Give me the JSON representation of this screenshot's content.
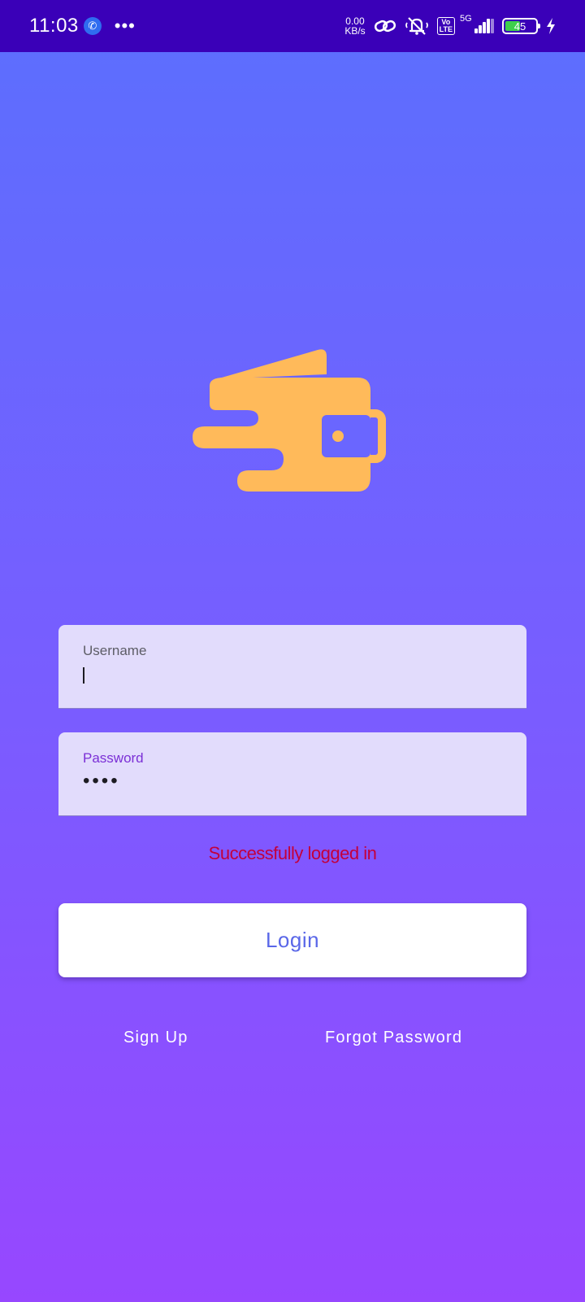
{
  "status_bar": {
    "time": "11:03",
    "overflow": "•••",
    "net_speed_value": "0.00",
    "net_speed_unit": "KB/s",
    "volte_top": "Vo",
    "volte_bottom": "LTE",
    "network": "5G",
    "battery": "45",
    "icons": [
      "phone-call-icon",
      "link-icon",
      "silent-bell-icon",
      "signal-icon",
      "battery-icon",
      "charging-icon"
    ]
  },
  "logo": {
    "icon": "wallet-icon",
    "color": "#ffba5a"
  },
  "username": {
    "label": "Username",
    "value": ""
  },
  "password": {
    "label": "Password",
    "value": "••••"
  },
  "status_message": "Successfully logged in",
  "login_button": "Login",
  "sign_up": "Sign Up",
  "forgot_password": "Forgot Password",
  "colors": {
    "status_bar": "#3a00b8",
    "gradient_top": "#5b6ffe",
    "gradient_bottom": "#9747ff",
    "field_bg": "#e2dcfc",
    "error_text": "#c3003b",
    "button_text": "#5a67e8"
  }
}
